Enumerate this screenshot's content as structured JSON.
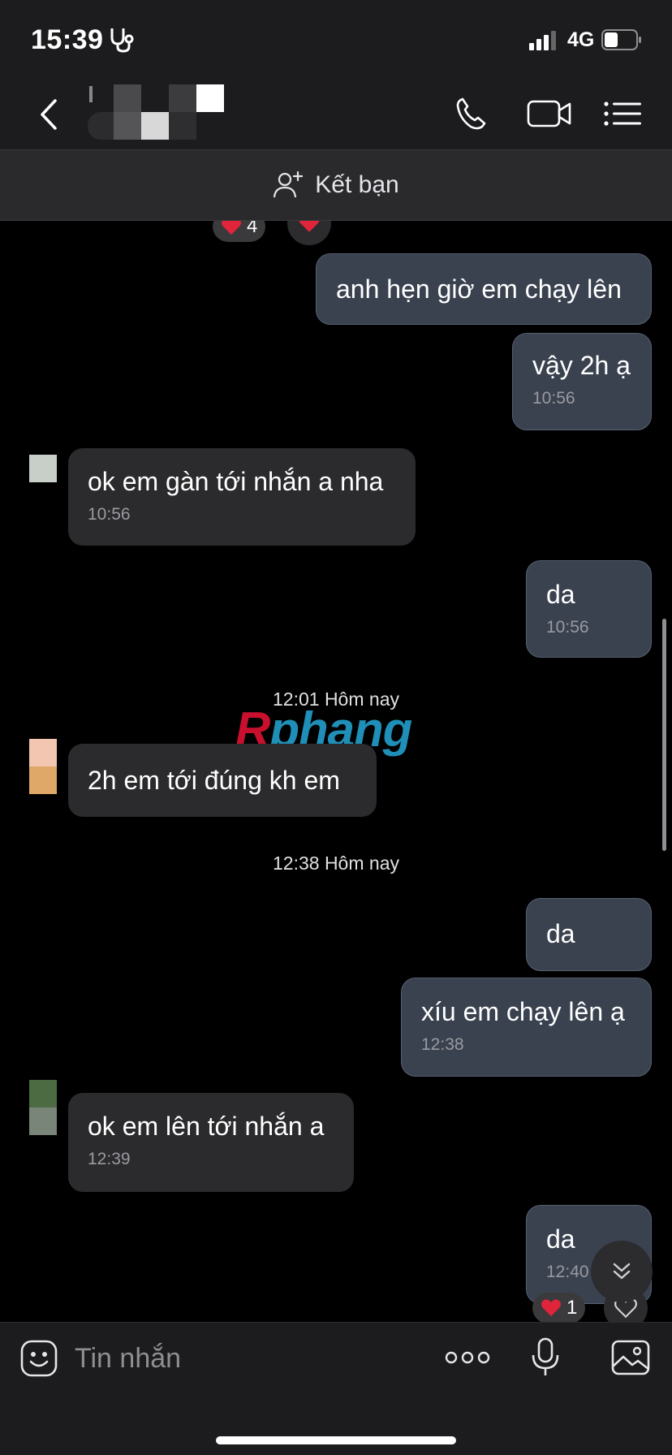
{
  "status_bar": {
    "time": "15:39",
    "network": "4G"
  },
  "header": {
    "friend_label": "Kết bạn"
  },
  "messages": [
    {
      "dir": "out",
      "text": "anh hẹn giờ em chạy lên",
      "time": ""
    },
    {
      "dir": "out",
      "text": "vậy 2h ạ",
      "time": "10:56"
    },
    {
      "dir": "in",
      "text": "ok em gàn tới nhắn a nha",
      "time": "10:56"
    },
    {
      "dir": "out",
      "text": "da",
      "time": "10:56"
    },
    {
      "dir": "in",
      "text": "2h em tới đúng kh em",
      "time": ""
    },
    {
      "dir": "out",
      "text": "da",
      "time": ""
    },
    {
      "dir": "out",
      "text": "xíu em chạy lên ạ",
      "time": "12:38"
    },
    {
      "dir": "in",
      "text": "ok em lên tới nhắn a",
      "time": "12:39"
    },
    {
      "dir": "out",
      "text": "da",
      "time": "12:40"
    }
  ],
  "separators": [
    "12:01 Hôm nay",
    "12:38 Hôm nay"
  ],
  "reactions": {
    "top_count": "4",
    "bottom_count": "1"
  },
  "watermark": {
    "first": "R",
    "rest": "phang"
  },
  "composer": {
    "placeholder": "Tin nhắn"
  },
  "colors": {
    "accent_heart": "#e0243a",
    "outgoing_bubble": "#3a4250",
    "incoming_bubble": "#2b2b2d"
  }
}
